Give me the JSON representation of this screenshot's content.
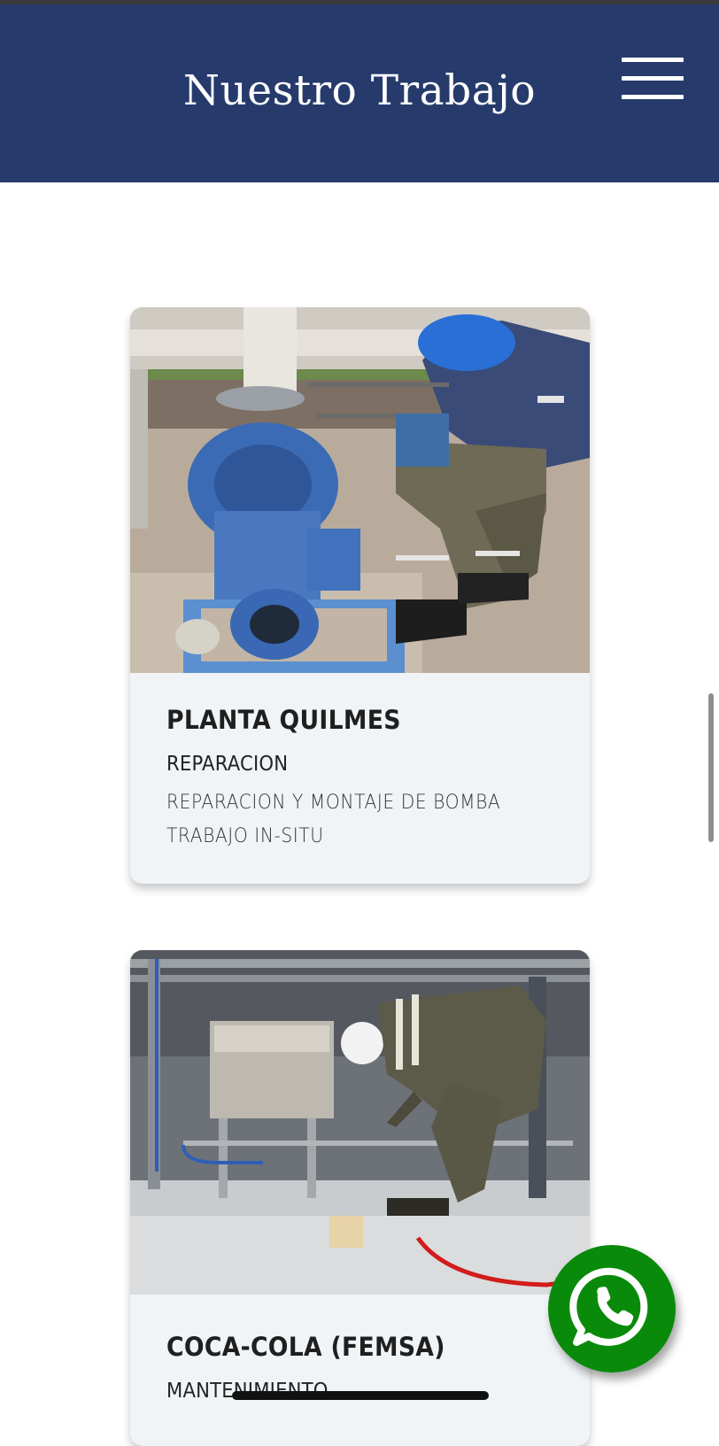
{
  "header": {
    "title": "Nuestro Trabajo",
    "background": "#263a6c",
    "menu_icon": "hamburger-menu-icon"
  },
  "projects": [
    {
      "title": "PLANTA QUILMES",
      "category": "REPARACION",
      "description_lines": [
        "REPARACION Y MONTAJE DE BOMBA",
        "TRABAJO IN-SITU"
      ]
    },
    {
      "title": "COCA-COLA (FEMSA)",
      "category": "MANTENIMIENTO"
    }
  ],
  "floating_action": {
    "icon": "whatsapp-icon",
    "color": "#0a8a0a"
  }
}
